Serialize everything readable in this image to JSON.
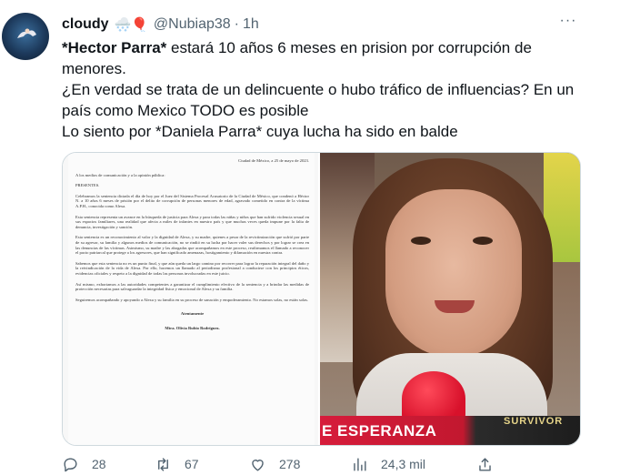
{
  "tweet": {
    "author_name": "cloudy",
    "author_emojis": "🌨️🎈",
    "handle": "@Nubiap38",
    "separator": "·",
    "time": "1h",
    "more_label": "···",
    "text_lines": [
      {
        "bold": "*Hector Parra*",
        "rest": " estará 10 años 6 meses en prision por corrupción de"
      },
      {
        "bold": "",
        "rest": "menores."
      },
      {
        "bold": "",
        "rest": "¿En verdad se trata de un delincuente o hubo tráfico de influencias? En un"
      },
      {
        "bold": "",
        "rest": "país como Mexico TODO es posible"
      },
      {
        "bold": "",
        "rest": "Lo siento por *Daniela Parra* cuya lucha ha sido en balde"
      }
    ]
  },
  "document": {
    "date": "Ciudad de México, a 25 de mayo de 2023.",
    "addressee": "A los medios de comunicación y a la opinión pública:",
    "greeting": "PRESENTES.",
    "paragraphs": [
      "Celebramos la sentencia dictada el día de hoy por el Juez del Sistema Procesal Acusatorio de la Ciudad de México, que condenó a Héctor N. a 10 años 6 meses de prisión por el delito de corrupción de personas menores de edad, agravado cometido en contra de la víctima A.P.H., conocida como Alexa.",
      "Esta sentencia representa un avance en la búsqueda de justicia para Alexa y para todas las niñas y niños que han sufrido violencia sexual en sus espacios familiares, una realidad que afecta a miles de infantes en nuestro país y que muchas veces queda impune por la falta de denuncia, investigación y sanción.",
      "Esta sentencia es un reconocimiento al valor y la dignidad de Alexa, y su madre, quienes a pesar de la revictimización que sufrió por parte de su agresor, su familia y algunos medios de comunicación, no se rindió en su lucha por hacer valer sus derechos y por lograr se crea en las denuncias de las víctimas. Asimismo, su madre y las abogadas que acompañamos en este proceso, reafirmamos el llamado a reconocer el pacto patriarcal que protege a los agresores, que han significado amenazas, hostigamiento y difamación en nuestra contra.",
      "Sabemos que esta sentencia no es un punto final, y que aún queda un largo camino por recorrer para lograr la reparación integral del daño y la reivindicación de la vida de Alexa. Por ello, hacemos un llamado al periodismo profesional a conducirse con los principios éticos, evidencias oficiales y respeto a la dignidad de todas las personas involucradas en este juicio.",
      "Así mismo, exhortamos a las autoridades competentes a garantizar el cumplimiento efectivo de la sentencia y a brindar las medidas de protección necesarias para salvaguardar la integridad física y emocional de Alexa y su familia.",
      "Seguiremos acompañando y apoyando a Alexa y su familia en su proceso de sanación y empoderamiento. No estamos solas, no están solas."
    ],
    "closing": "Atentamente",
    "signature": "Mtra. Olivia Rubio Rodríguez."
  },
  "photo": {
    "banner_text": "E ESPERANZA",
    "logo_text": "SURVIVOR"
  },
  "actions": {
    "replies": "28",
    "reposts": "67",
    "likes": "278",
    "views": "24,3 mil"
  },
  "colors": {
    "text": "#0f1419",
    "muted": "#536471",
    "border": "#cfd9de",
    "banner": "#d61c3b"
  },
  "icons": [
    "reply-icon",
    "repost-icon",
    "like-icon",
    "views-icon",
    "share-icon",
    "more-icon"
  ]
}
